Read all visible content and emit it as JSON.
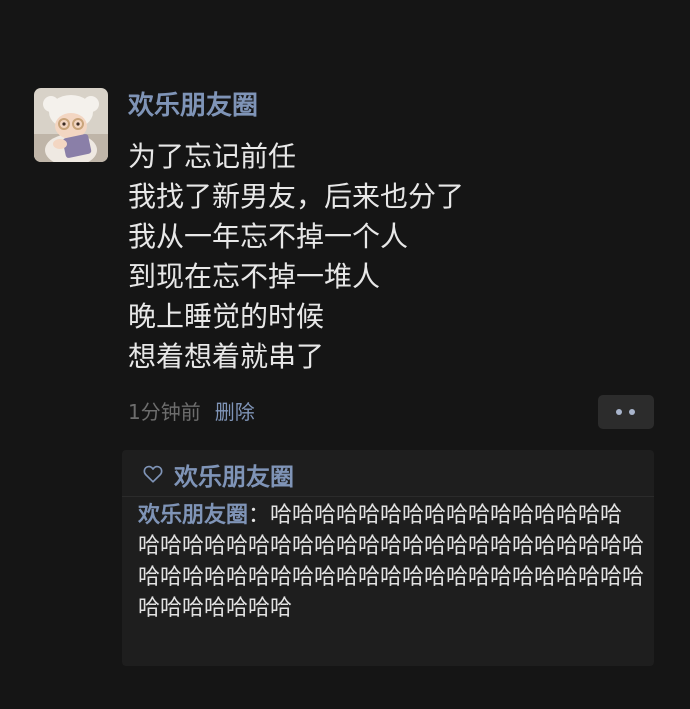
{
  "post": {
    "author": "欢乐朋友圈",
    "lines": [
      "为了忘记前任",
      "我找了新男友，后来也分了",
      "我从一年忘不掉一个人",
      "到现在忘不掉一堆人",
      "晚上睡觉的时候",
      "想着想着就串了"
    ],
    "time": "1分钟前",
    "delete_label": "删除"
  },
  "likes": {
    "icon": "heart-outline-icon",
    "names": "欢乐朋友圈"
  },
  "comments": [
    {
      "author": "欢乐朋友圈",
      "separator": "：",
      "text": "哈哈哈哈哈哈哈哈哈哈哈哈哈哈哈哈哈哈哈哈哈哈哈哈哈哈哈哈哈哈哈哈哈哈哈哈哈哈哈哈哈哈哈哈哈哈哈哈哈哈哈哈哈哈哈哈哈哈哈哈哈哈哈哈哈哈哈哈哈"
    }
  ],
  "colors": {
    "background": "#151515",
    "link": "#7f94b7",
    "text": "#e7e7e7",
    "muted": "#6d6d6d",
    "panel": "#1e1e1e"
  }
}
